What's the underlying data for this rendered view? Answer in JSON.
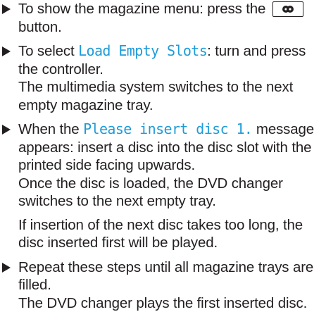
{
  "steps": [
    {
      "before": "To show the magazine menu: press the",
      "button_icon": "disc-button-icon",
      "after": "button."
    },
    {
      "prefix": "To select ",
      "display": "Load Empty Slots",
      "suffix": ": turn and press the controller.",
      "line2": "The multimedia system switches to the next empty magazine tray."
    },
    {
      "prefix": "When the ",
      "display": "Please insert disc 1.",
      "suffix": " message appears: insert a disc into the disc slot with the printed side facing upwards.",
      "line2": "Once the disc is loaded, the DVD changer switches to the next empty tray.",
      "note": "If insertion of the next disc takes too long, the disc inserted first will be played."
    },
    {
      "text": "Repeat these steps until all magazine trays are filled.",
      "line2": "The DVD changer plays the first inserted disc."
    }
  ],
  "colors": {
    "text": "#231f20",
    "display": "#1f9bd7"
  }
}
